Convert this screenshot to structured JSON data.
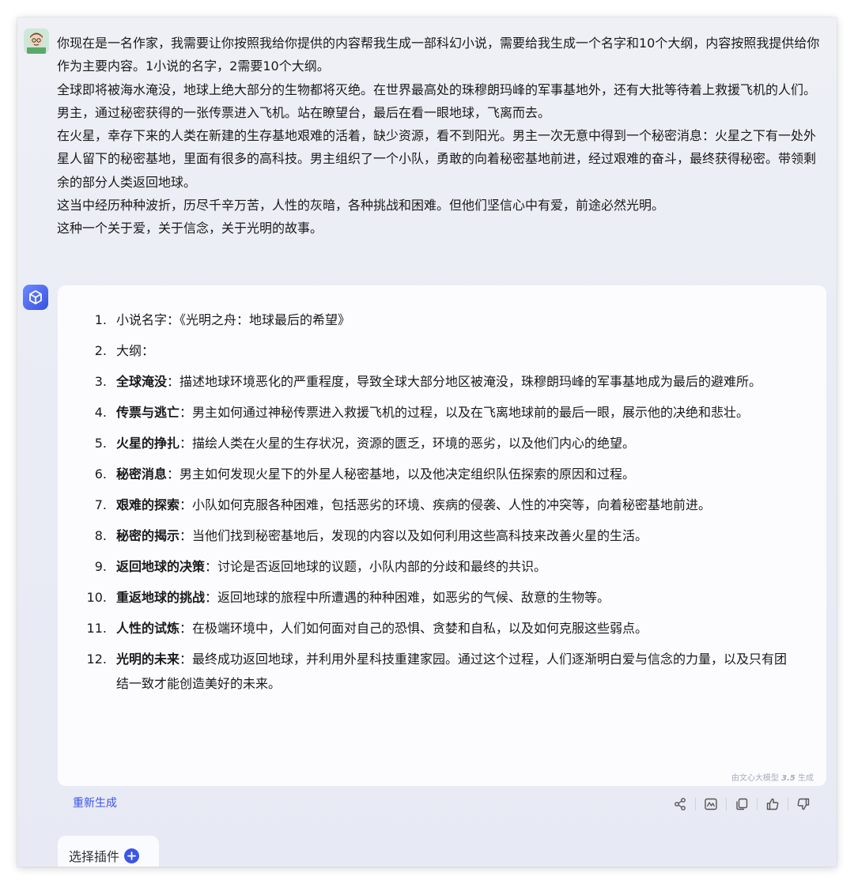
{
  "user_message": {
    "paragraphs": [
      "你现在是一名作家，我需要让你按照我给你提供的内容帮我生成一部科幻小说，需要给我生成一个名字和10个大纲，内容按照我提供给你作为主要内容。1小说的名字，2需要10个大纲。",
      "全球即将被海水淹没，地球上绝大部分的生物都将灭绝。在世界最高处的珠穆朗玛峰的军事基地外，还有大批等待着上救援飞机的人们。",
      "男主，通过秘密获得的一张传票进入飞机。站在瞭望台，最后在看一眼地球，飞离而去。",
      "在火星，幸存下来的人类在新建的生存基地艰难的活着，缺少资源，看不到阳光。男主一次无意中得到一个秘密消息：火星之下有一处外星人留下的秘密基地，里面有很多的高科技。男主组织了一个小队，勇敢的向着秘密基地前进，经过艰难的奋斗，最终获得秘密。带领剩余的部分人类返回地球。",
      "这当中经历种种波折，历尽千辛万苦，人性的灰暗，各种挑战和困难。但他们坚信心中有爱，前途必然光明。",
      "这种一个关于爱，关于信念，关于光明的故事。"
    ]
  },
  "answer": {
    "items": [
      {
        "num": "1.",
        "label": "",
        "text": "小说名字：《光明之舟：地球最后的希望》"
      },
      {
        "num": "2.",
        "label": "",
        "text": "大纲："
      },
      {
        "num": "3.",
        "label": "全球淹没",
        "text": "：描述地球环境恶化的严重程度，导致全球大部分地区被淹没，珠穆朗玛峰的军事基地成为最后的避难所。"
      },
      {
        "num": "4.",
        "label": "传票与逃亡",
        "text": "：男主如何通过神秘传票进入救援飞机的过程，以及在飞离地球前的最后一眼，展示他的决绝和悲壮。"
      },
      {
        "num": "5.",
        "label": "火星的挣扎",
        "text": "：描绘人类在火星的生存状况，资源的匮乏，环境的恶劣，以及他们内心的绝望。"
      },
      {
        "num": "6.",
        "label": "秘密消息",
        "text": "：男主如何发现火星下的外星人秘密基地，以及他决定组织队伍探索的原因和过程。"
      },
      {
        "num": "7.",
        "label": "艰难的探索",
        "text": "：小队如何克服各种困难，包括恶劣的环境、疾病的侵袭、人性的冲突等，向着秘密基地前进。"
      },
      {
        "num": "8.",
        "label": "秘密的揭示",
        "text": "：当他们找到秘密基地后，发现的内容以及如何利用这些高科技来改善火星的生活。"
      },
      {
        "num": "9.",
        "label": "返回地球的决策",
        "text": "：讨论是否返回地球的议题，小队内部的分歧和最终的共识。"
      },
      {
        "num": "10.",
        "label": "重返地球的挑战",
        "text": "：返回地球的旅程中所遭遇的种种困难，如恶劣的气候、敌意的生物等。"
      },
      {
        "num": "11.",
        "label": "人性的试炼",
        "text": "：在极端环境中，人们如何面对自己的恐惧、贪婪和自私，以及如何克服这些弱点。"
      },
      {
        "num": "12.",
        "label": "光明的未来",
        "text": "：最终成功返回地球，并利用外星科技重建家园。通过这个过程，人们逐渐明白爱与信念的力量，以及只有团结一致才能创造美好的未来。"
      }
    ],
    "watermark_prefix": "由文心大模型 ",
    "watermark_version": "3.5",
    "watermark_suffix": " 生成"
  },
  "actions": {
    "regenerate_label": "重新生成",
    "icons": [
      "share-icon",
      "image-icon",
      "copy-icon",
      "thumbs-up-icon",
      "thumbs-down-icon"
    ]
  },
  "plugin": {
    "label": "选择插件"
  },
  "colors": {
    "accent": "#3c55e6",
    "background": "#eceef6",
    "card": "#fcfcff"
  }
}
